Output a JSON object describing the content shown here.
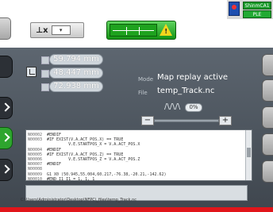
{
  "toolbar": {
    "axis_glyph": "⊥x",
    "axis_dropdown": "▾",
    "mode_button_icon": "track-warning-icon",
    "warning_mark": "!"
  },
  "corner_badges": {
    "top": "ShinmCA1",
    "bottom": "PLE"
  },
  "coords": [
    {
      "label": "",
      "value": "59.794 mm"
    },
    {
      "label": "",
      "value": "48.447 mm"
    },
    {
      "label": "",
      "value": "72.938 mm"
    }
  ],
  "info": {
    "mode_label": "Mode",
    "mode_value": "Map replay active",
    "file_label": "File",
    "file_value": "temp_Track.nc"
  },
  "speed": {
    "icon": "/\\/\\/\\",
    "percent_text": "0%",
    "percent_fraction": 0.0,
    "minus": "−",
    "plus": "+"
  },
  "code_lines": [
    {
      "num": "N00002",
      "text": "#ENDIF"
    },
    {
      "num": "N00003",
      "text": "#IF EXIST(V.A.ACT_POS.X) == TRUE"
    },
    {
      "num": "",
      "text": "         V.E.STARTPOS_X = V.A.ACT_POS.X"
    },
    {
      "num": "N00004",
      "text": "#ENDIF"
    },
    {
      "num": "N00005",
      "text": "#IF EXIST(V.A.ACT_POS.Z) == TRUE"
    },
    {
      "num": "N00006",
      "text": "         V.E.STARTPOS_Z = V.A.ACT_POS.Z"
    },
    {
      "num": "N00007",
      "text": "#ENDIF"
    },
    {
      "num": "N00008",
      "text": ""
    },
    {
      "num": "N00009",
      "text": "G1 X0 (50.945,55.004,60.217,-76.38,-20.21,-142.62)"
    },
    {
      "num": "N00010",
      "text": "#END I1 I1 = 1, 1, 1"
    }
  ],
  "status": {
    "path": "C:\\Users\\Administrator\\Desktop\\NFPC\\_files\\temp_Track.nc"
  },
  "colors": {
    "accent_green": "#1ea21e",
    "warning_yellow": "#f4d51c",
    "brand_red": "#e1151a"
  }
}
